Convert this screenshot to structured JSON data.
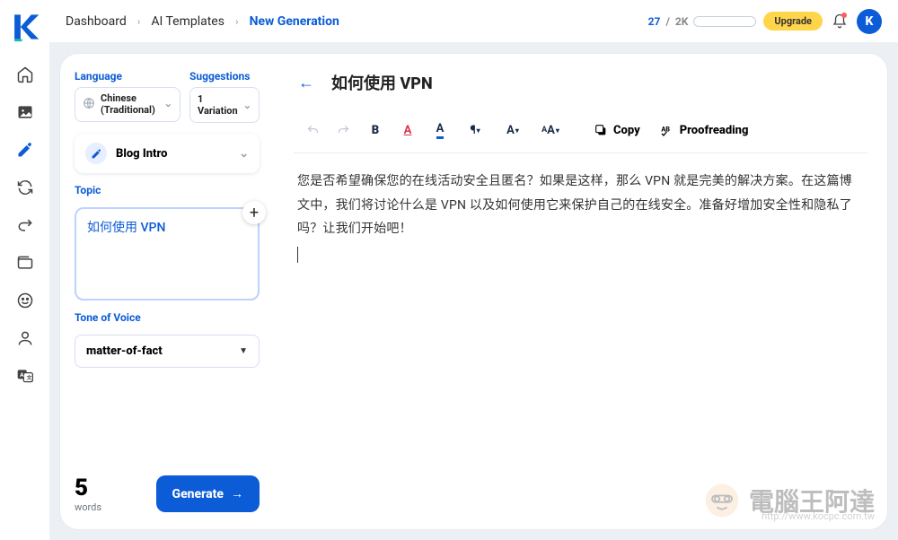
{
  "breadcrumbs": {
    "a": "Dashboard",
    "b": "AI Templates",
    "c": "New Generation"
  },
  "header": {
    "usage_current": "27",
    "usage_max": "2K",
    "upgrade": "Upgrade",
    "avatar_letter": "K"
  },
  "panel": {
    "language_label": "Language",
    "language_value": "Chinese (Traditional)",
    "suggestions_label": "Suggestions",
    "suggestions_value": "1 Variation",
    "template": "Blog Intro",
    "topic_label": "Topic",
    "topic_value": "如何使用 VPN",
    "tone_label": "Tone of Voice",
    "tone_value": "matter-of-fact",
    "word_count": "5",
    "word_unit": "words",
    "generate": "Generate"
  },
  "editor": {
    "title": "如何使用 VPN",
    "copy": "Copy",
    "proofreading": "Proofreading",
    "body": "您是否希望确保您的在线活动安全且匿名？如果是这样，那么 VPN 就是完美的解决方案。在这篇博文中，我们将讨论什么是 VPN 以及如何使用它来保护自己的在线安全。准备好增加安全性和隐私了吗？让我们开始吧！"
  },
  "watermark": {
    "text": "電腦王阿達",
    "url": "http://www.kocpc.com.tw"
  },
  "icons": {
    "home": "home-icon",
    "image": "image-icon",
    "pencil": "pencil-icon",
    "refresh": "refresh-icon",
    "redo": "redo-icon",
    "wallet": "wallet-icon",
    "smile": "smile-icon",
    "user": "user-icon",
    "translate": "translate-icon"
  }
}
